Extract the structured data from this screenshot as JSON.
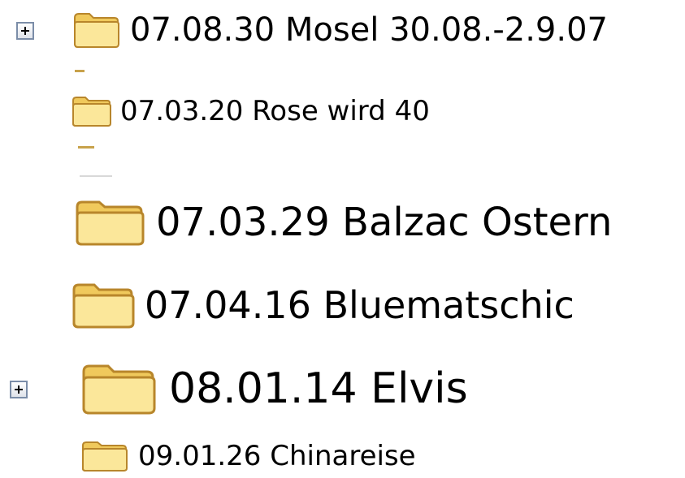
{
  "tree": {
    "items": [
      {
        "label": "07.08.30 Mosel 30.08.-2.9.07",
        "expandable": true
      },
      {
        "label": "07.03.20 Rose wird 40",
        "expandable": false
      },
      {
        "label": "07.03.29 Balzac Ostern",
        "expandable": false
      },
      {
        "label": "07.04.16 Bluematschic",
        "expandable": false
      },
      {
        "label": "08.01.14 Elvis",
        "expandable": true
      },
      {
        "label": "09.01.26 Chinareise",
        "expandable": false
      }
    ]
  },
  "icons": {
    "folder": "folder-icon",
    "expand": "plus-expand-icon"
  },
  "colors": {
    "folder_fill": "#f5d56a",
    "folder_outline": "#b8862b",
    "folder_front": "#fbe79a",
    "expander_border": "#7b8da8",
    "text": "#000000",
    "background": "#ffffff"
  }
}
